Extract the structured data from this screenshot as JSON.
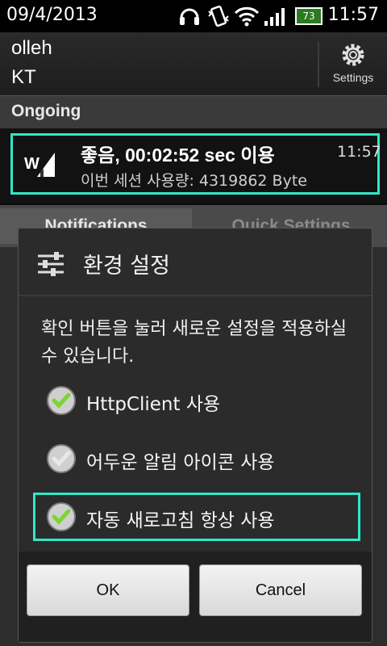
{
  "status_bar": {
    "date": "09/4/2013",
    "time": "11:57",
    "battery_level": "73",
    "icons": [
      "headset-icon",
      "vibrate-icon",
      "wifi-icon",
      "signal-icon",
      "battery-icon"
    ]
  },
  "carrier": {
    "line1": "olleh",
    "line2": "KT",
    "settings_label": "Settings"
  },
  "ongoing": {
    "header": "Ongoing",
    "item": {
      "title": "좋음, 00:02:52 sec 이용",
      "subtitle": "이번 세션 사용량: 4319862 Byte",
      "time": "11:57",
      "icon": "signal-app-icon"
    }
  },
  "tabs": {
    "notifications": "Notifications",
    "quick_settings": "Quick Settings"
  },
  "dialog": {
    "title": "환경 설정",
    "message": "확인 버튼을 눌러 새로운 설정을 적용하실 수 있습니다.",
    "options": [
      {
        "label": "HttpClient 사용",
        "checked": true
      },
      {
        "label": "어두운 알림 아이콘 사용",
        "checked": false
      },
      {
        "label": "자동 새로고침 항상 사용",
        "checked": true
      }
    ],
    "ok_label": "OK",
    "cancel_label": "Cancel"
  },
  "colors": {
    "highlight": "#2ee8c8",
    "check_on": "#7bd631",
    "check_off": "#d8d8d8"
  }
}
